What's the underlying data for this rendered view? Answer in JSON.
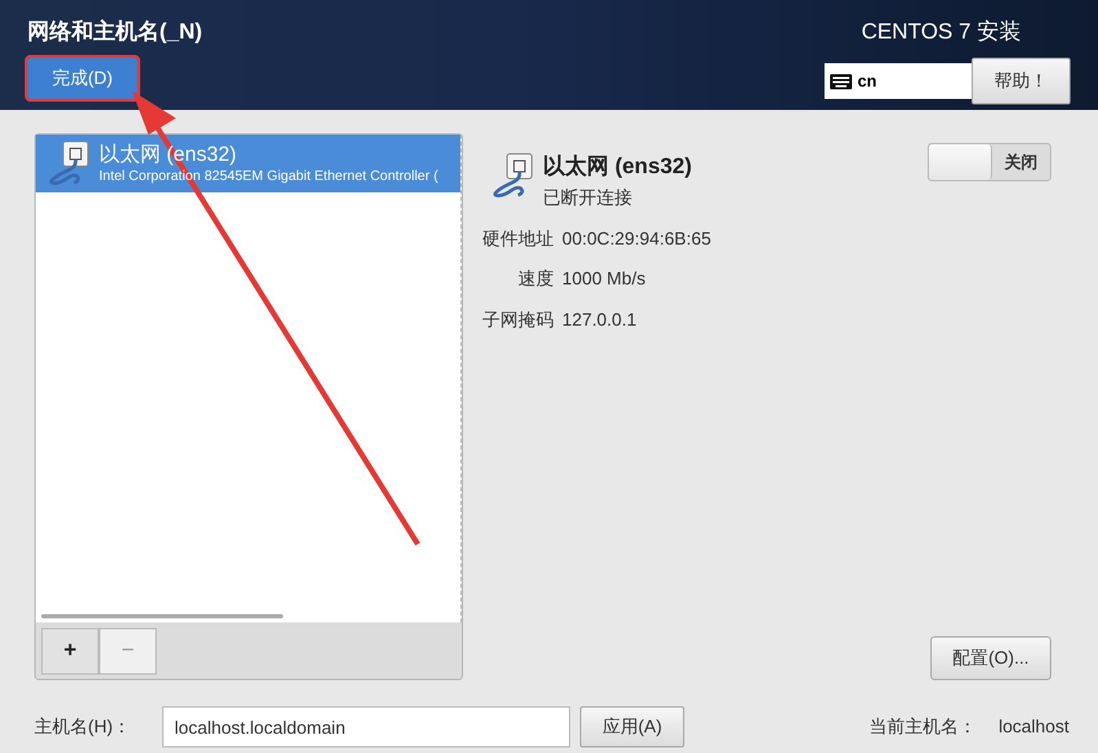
{
  "header": {
    "title": "网络和主机名(_N)",
    "done_button": "完成(D)",
    "product": "CENTOS 7 安装",
    "keyboard_layout": "cn",
    "help_button": "帮助！"
  },
  "devices": [
    {
      "name": "以太网 (ens32)",
      "description": "Intel Corporation 82545EM Gigabit Ethernet Controller (",
      "selected": true
    }
  ],
  "list_buttons": [
    {
      "label": "+",
      "disabled": false
    },
    {
      "label": "−",
      "disabled": true
    }
  ],
  "detail": {
    "name": "以太网 (ens32)",
    "status": "已断开连接",
    "toggle": {
      "on": false,
      "label": "关闭"
    },
    "properties": [
      {
        "label": "硬件地址",
        "value": "00:0C:29:94:6B:65"
      },
      {
        "label": "速度",
        "value": "1000 Mb/s"
      },
      {
        "label": "子网掩码",
        "value": "127.0.0.1"
      }
    ],
    "configure_button": "配置(O)..."
  },
  "hostname": {
    "label": "主机名(H)：",
    "value": "localhost.localdomain",
    "apply_button": "应用(A)",
    "current_label": "当前主机名：",
    "current_value": "localhost"
  }
}
